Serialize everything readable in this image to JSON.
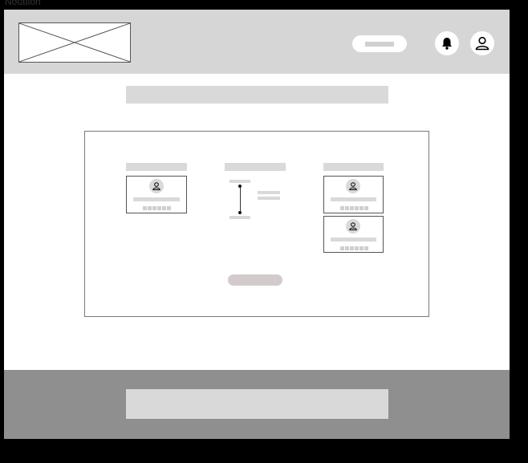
{
  "notation": {
    "label": "Notation"
  },
  "header": {
    "logo_placeholder": "logo-placeholder",
    "action_button": "pill-button",
    "icons": [
      "bell-icon",
      "user-icon"
    ]
  },
  "card": {
    "columns": [
      {
        "heading": "",
        "items": 1
      },
      {
        "heading": "",
        "timeline": true
      },
      {
        "heading": "",
        "items": 2
      }
    ]
  },
  "colors": {
    "background": "#000000",
    "header": "#d6d6d6",
    "placeholder": "#d9d9d9",
    "footer": "#8f8f8f",
    "button": "#d3cbcb"
  }
}
